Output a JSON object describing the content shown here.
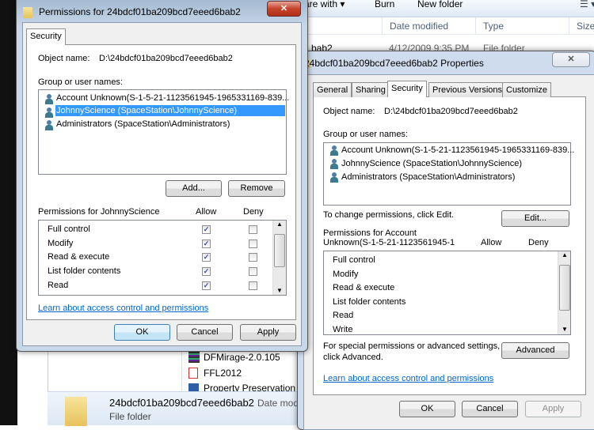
{
  "explorer": {
    "toolbar": {
      "share_with": "are with",
      "burn": "Burn",
      "new_folder": "New folder"
    },
    "columns": {
      "date_modified": "Date modified",
      "type": "Type",
      "size": "Size"
    },
    "row": {
      "name": "bab2",
      "date": "4/12/2009 9:35 PM",
      "type": "File folder"
    },
    "nav_items": [
      "DFMirage-2.0.105",
      "FFL2012",
      "Property Preservation"
    ],
    "details": {
      "name": "24bdcf01ba209bcd7eeed6bab2",
      "date_label": "Date modi",
      "type": "File folder"
    }
  },
  "perm_dialog": {
    "title": "Permissions for 24bdcf01ba209bcd7eeed6bab2",
    "close": "✕",
    "tab": "Security",
    "object_label": "Object name:",
    "object_value": "D:\\24bdcf01ba209bcd7eeed6bab2",
    "group_label": "Group or user names:",
    "users": [
      "Account Unknown(S-1-5-21-1123561945-1965331169-839...",
      "JohnnyScience (SpaceStation\\JohnnyScience)",
      "Administrators (SpaceStation\\Administrators)"
    ],
    "selected_user_index": 1,
    "add": "Add...",
    "remove": "Remove",
    "perms_label": "Permissions for JohnnyScience",
    "allow": "Allow",
    "deny": "Deny",
    "perms": [
      {
        "name": "Full control",
        "allow": true,
        "deny": false
      },
      {
        "name": "Modify",
        "allow": true,
        "deny": false
      },
      {
        "name": "Read & execute",
        "allow": true,
        "deny": false
      },
      {
        "name": "List folder contents",
        "allow": true,
        "deny": false
      },
      {
        "name": "Read",
        "allow": true,
        "deny": false
      }
    ],
    "link": "Learn about access control and permissions",
    "ok": "OK",
    "cancel": "Cancel",
    "apply": "Apply"
  },
  "props_dialog": {
    "title": "24bdcf01ba209bcd7eeed6bab2 Properties",
    "close": "✕",
    "tabs": [
      "General",
      "Sharing",
      "Security",
      "Previous Versions",
      "Customize"
    ],
    "active_tab": "Security",
    "object_label": "Object name:",
    "object_value": "D:\\24bdcf01ba209bcd7eeed6bab2",
    "group_label": "Group or user names:",
    "users": [
      "Account Unknown(S-1-5-21-1123561945-1965331169-839...",
      "JohnnyScience (SpaceStation\\JohnnyScience)",
      "Administrators (SpaceStation\\Administrators)"
    ],
    "change_text": "To change permissions, click Edit.",
    "edit": "Edit...",
    "perms_label_1": "Permissions for Account",
    "perms_label_2": "Unknown(S-1-5-21-1123561945-1",
    "allow": "Allow",
    "deny": "Deny",
    "perms": [
      "Full control",
      "Modify",
      "Read & execute",
      "List folder contents",
      "Read",
      "Write"
    ],
    "special_1": "For special permissions or advanced settings,",
    "special_2": "click Advanced.",
    "advanced": "Advanced",
    "link": "Learn about access control and permissions",
    "ok": "OK",
    "cancel": "Cancel",
    "apply": "Apply"
  }
}
